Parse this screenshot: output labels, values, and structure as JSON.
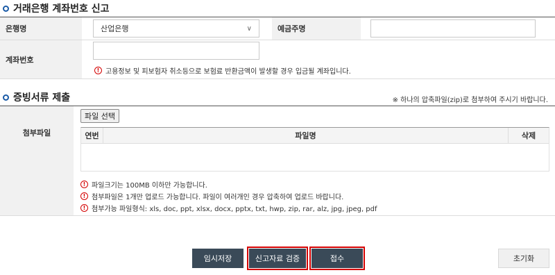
{
  "section1": {
    "title": "거래은행 계좌번호 신고",
    "bank_label": "은행명",
    "bank_selected": "산업은행",
    "holder_label": "예금주명",
    "account_label": "계좌번호",
    "account_warning": "고용정보 및 피보험자 취소등으로 보험료 반환금액이 발생할 경우 입금될 계좌입니다."
  },
  "section2": {
    "title": "증빙서류 제출",
    "note": "※ 하나의 압축파일(zip)로 첨부하여 주시기 바랍니다.",
    "attach_label": "첨부파일",
    "file_button": "파일 선택",
    "columns": [
      "연번",
      "파일명",
      "삭제"
    ],
    "warnings": [
      "파일크기는 100MB 이하만 가능합니다.",
      "첨부파일은 1개만 업로드 가능합니다. 파일이 여러개인 경우 압축하여 업로드 바랍니다.",
      "첨부가능 파일형식: xls, doc, ppt, xlsx, docx, pptx, txt, hwp, zip, rar, alz, jpg, jpeg, pdf"
    ]
  },
  "buttons": {
    "temp_save": "임시저장",
    "verify": "신고자료 검증",
    "submit": "접수",
    "reset": "초기화"
  },
  "colors": {
    "bullet": "#1a5aa6",
    "button_dark": "#3a4a58",
    "highlight_outline": "#d40000",
    "label_bg": "#f1f1f1"
  },
  "icons": {
    "warning": "exclamation-circle-icon",
    "section_bullet": "circle-bullet-icon",
    "dropdown": "chevron-down-icon"
  }
}
